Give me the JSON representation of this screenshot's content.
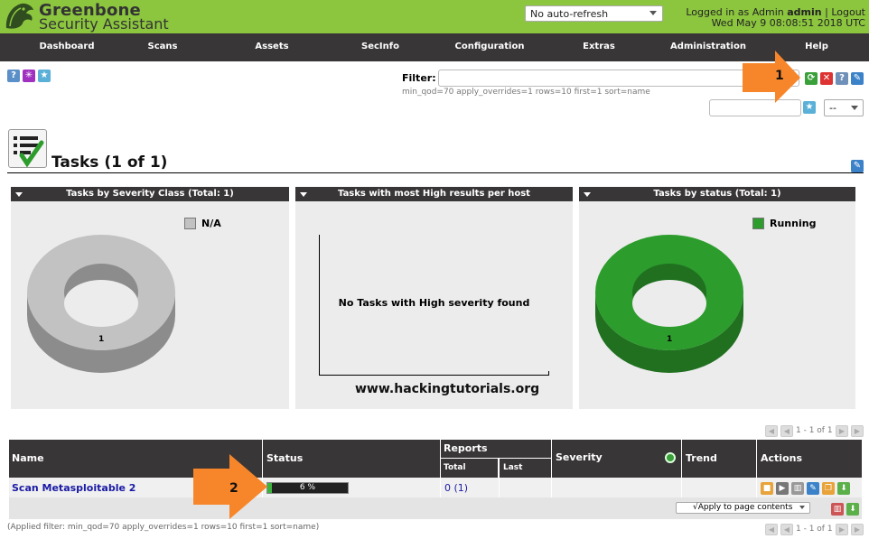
{
  "header": {
    "brand_line1": "Greenbone",
    "brand_line2": "Security Assistant",
    "refresh_value": "No auto-refresh",
    "logged_in_prefix": "Logged in as",
    "role": "Admin",
    "username": "admin",
    "logout": "Logout",
    "datetime": "Wed May 9 08:08:51 2018 UTC"
  },
  "nav": [
    "Dashboard",
    "Scans",
    "Assets",
    "SecInfo",
    "Configuration",
    "Extras",
    "Administration",
    "Help"
  ],
  "toolbar": {
    "help_glyph": "?",
    "wizard_glyph": "✳",
    "new_glyph": "★"
  },
  "filter": {
    "label": "Filter:",
    "value": "",
    "current": "min_qod=70 apply_overrides=1 rows=10 first=1 sort=name",
    "select_value": "--"
  },
  "page": {
    "title": "Tasks (1 of 1)"
  },
  "charts": {
    "severity": {
      "title": "Tasks by Severity Class (Total: 1)",
      "legend": "N/A",
      "slice_label": "1",
      "color": "#c2c2c2"
    },
    "high": {
      "title": "Tasks with most High results per host",
      "message": "No Tasks with High severity found"
    },
    "status": {
      "title": "Tasks by status (Total: 1)",
      "legend": "Running",
      "slice_label": "1",
      "color": "#2c9c2c"
    }
  },
  "chart_data": [
    {
      "type": "pie",
      "title": "Tasks by Severity Class (Total: 1)",
      "categories": [
        "N/A"
      ],
      "values": [
        1
      ],
      "legend": "top-right"
    },
    {
      "type": "bar",
      "title": "Tasks with most High results per host",
      "categories": [],
      "values": []
    },
    {
      "type": "pie",
      "title": "Tasks by status (Total: 1)",
      "categories": [
        "Running"
      ],
      "values": [
        1
      ],
      "legend": "top-right"
    }
  ],
  "watermark": "www.hackingtutorials.org",
  "pagination": {
    "top": "1 - 1 of 1",
    "bottom": "1 - 1 of 1"
  },
  "table": {
    "headers": {
      "name": "Name",
      "status": "Status",
      "reports": "Reports",
      "total": "Total",
      "last": "Last",
      "severity": "Severity",
      "trend": "Trend",
      "actions": "Actions"
    },
    "rows": [
      {
        "name": "Scan Metasploitable 2",
        "status_text": "6 %",
        "progress": 0.06,
        "reports_total": "0 (1)",
        "last": "",
        "severity": "",
        "trend": ""
      }
    ],
    "apply_label": "√Apply to page contents",
    "applied_filter": "(Applied filter: min_qod=70 apply_overrides=1 rows=10 first=1 sort=name)"
  },
  "callouts": [
    "1",
    "2"
  ]
}
